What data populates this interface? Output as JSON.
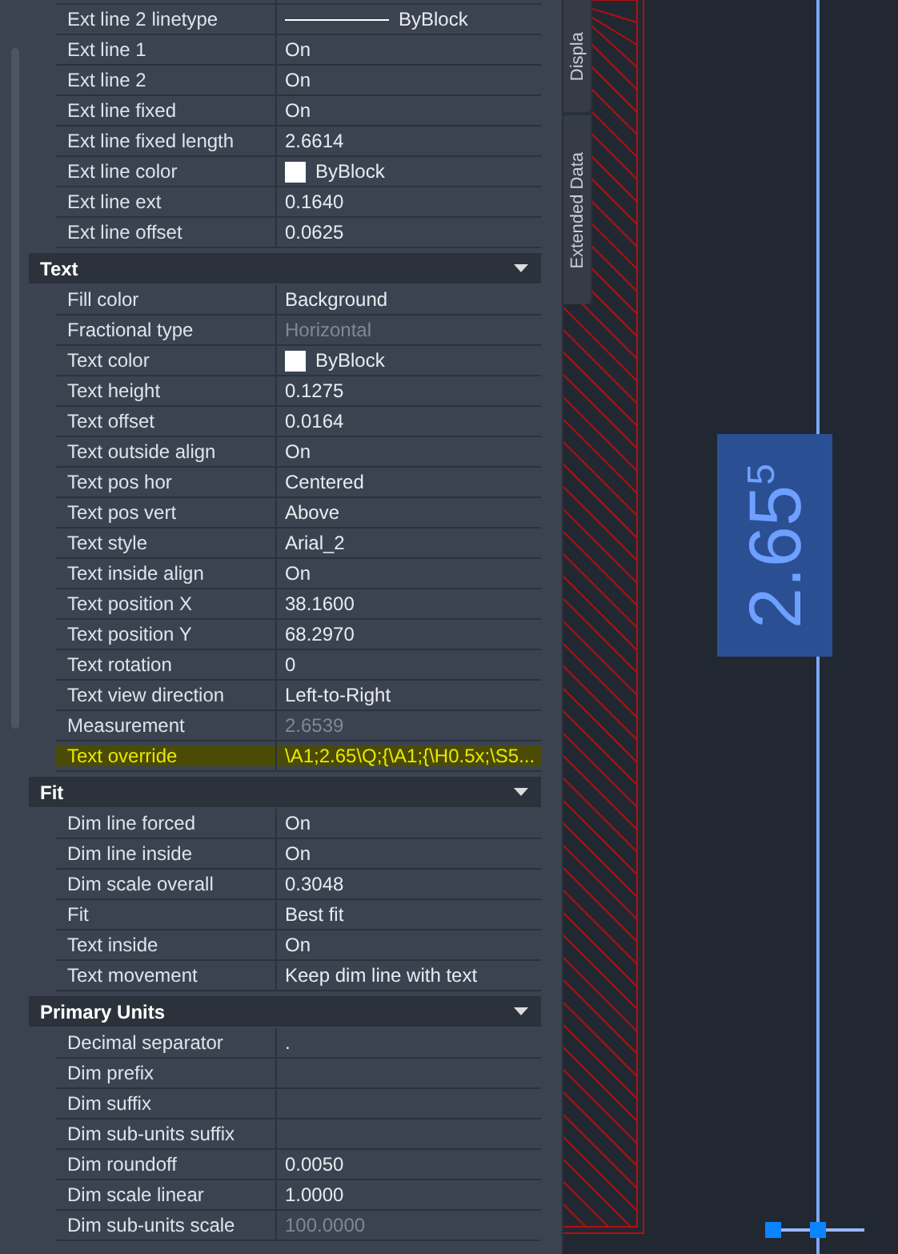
{
  "properties": {
    "groups": [
      {
        "rows": [
          {
            "label": "Ext line 2 linetype",
            "value": "ByBlock",
            "kind": "linetype"
          },
          {
            "label": "Ext line 1",
            "value": "On",
            "kind": "text"
          },
          {
            "label": "Ext line 2",
            "value": "On",
            "kind": "text"
          },
          {
            "label": "Ext line fixed",
            "value": "On",
            "kind": "text"
          },
          {
            "label": "Ext line fixed length",
            "value": "2.6614",
            "kind": "text"
          },
          {
            "label": "Ext line color",
            "value": "ByBlock",
            "kind": "color"
          },
          {
            "label": "Ext line ext",
            "value": "0.1640",
            "kind": "text"
          },
          {
            "label": "Ext line offset",
            "value": "0.0625",
            "kind": "text"
          }
        ]
      },
      {
        "title": "Text",
        "expanded": true,
        "rows": [
          {
            "label": "Fill color",
            "value": "Background",
            "kind": "text"
          },
          {
            "label": "Fractional type",
            "value": "Horizontal",
            "kind": "text",
            "disabled": true
          },
          {
            "label": "Text color",
            "value": "ByBlock",
            "kind": "color"
          },
          {
            "label": "Text height",
            "value": "0.1275",
            "kind": "text"
          },
          {
            "label": "Text offset",
            "value": "0.0164",
            "kind": "text"
          },
          {
            "label": "Text outside align",
            "value": "On",
            "kind": "text"
          },
          {
            "label": "Text pos hor",
            "value": "Centered",
            "kind": "text"
          },
          {
            "label": "Text pos vert",
            "value": "Above",
            "kind": "text"
          },
          {
            "label": "Text style",
            "value": "Arial_2",
            "kind": "text"
          },
          {
            "label": "Text inside align",
            "value": "On",
            "kind": "text"
          },
          {
            "label": "Text position X",
            "value": "38.1600",
            "kind": "text"
          },
          {
            "label": "Text position Y",
            "value": "68.2970",
            "kind": "text"
          },
          {
            "label": "Text rotation",
            "value": "0",
            "kind": "text"
          },
          {
            "label": "Text view direction",
            "value": "Left-to-Right",
            "kind": "text"
          },
          {
            "label": "Measurement",
            "value": "2.6539",
            "kind": "text",
            "disabled": true
          },
          {
            "label": "Text override",
            "value": "\\A1;2.65\\Q;{\\A1;{\\H0.5x;\\S5...",
            "kind": "text",
            "highlighted": true
          }
        ]
      },
      {
        "title": "Fit",
        "expanded": true,
        "rows": [
          {
            "label": "Dim line forced",
            "value": "On",
            "kind": "text"
          },
          {
            "label": "Dim line inside",
            "value": "On",
            "kind": "text"
          },
          {
            "label": "Dim scale overall",
            "value": "0.3048",
            "kind": "text"
          },
          {
            "label": "Fit",
            "value": "Best fit",
            "kind": "text"
          },
          {
            "label": "Text inside",
            "value": "On",
            "kind": "text"
          },
          {
            "label": "Text movement",
            "value": "Keep dim line with text",
            "kind": "text"
          }
        ]
      },
      {
        "title": "Primary Units",
        "expanded": true,
        "rows": [
          {
            "label": "Decimal separator",
            "value": ".",
            "kind": "text"
          },
          {
            "label": "Dim prefix",
            "kind": "text"
          },
          {
            "label": "Dim suffix",
            "kind": "text"
          },
          {
            "label": "Dim sub-units suffix",
            "kind": "text"
          },
          {
            "label": "Dim roundoff",
            "value": "0.0050",
            "kind": "text"
          },
          {
            "label": "Dim scale linear",
            "value": "1.0000",
            "kind": "text"
          },
          {
            "label": "Dim sub-units scale",
            "value": "100.0000",
            "kind": "text",
            "disabled": true
          }
        ]
      }
    ]
  },
  "side_tabs": [
    {
      "label": "Displa"
    },
    {
      "label": "Extended Data"
    }
  ],
  "canvas": {
    "dimension_text": "2.65$^{5}$"
  }
}
